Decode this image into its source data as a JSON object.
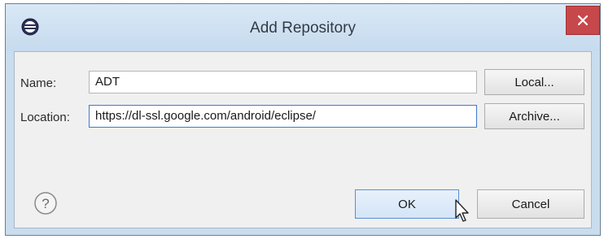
{
  "window": {
    "title": "Add Repository"
  },
  "form": {
    "name_label": "Name:",
    "name_value": "ADT",
    "location_label": "Location:",
    "location_value": "https://dl-ssl.google.com/android/eclipse/"
  },
  "buttons": {
    "local": "Local...",
    "archive": "Archive...",
    "ok": "OK",
    "cancel": "Cancel",
    "help": "?"
  },
  "icons": {
    "app": "eclipse-icon",
    "close": "close-icon",
    "help": "help-icon",
    "cursor": "mouse-pointer-icon"
  },
  "colors": {
    "titlebar": "#c6dbee",
    "close_button": "#c7484a",
    "focus_border": "#3d7bcf"
  }
}
